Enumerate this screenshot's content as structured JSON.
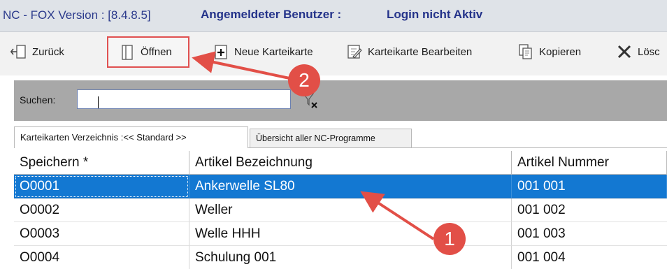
{
  "titlebar": {
    "version": "NC - FOX Version : [8.4.8.5]",
    "user_label": "Angemeldeter Benutzer :",
    "user_value": "Login nicht Aktiv"
  },
  "toolbar": {
    "back_label": "Zurück",
    "open_label": "Öffnen",
    "new_label": "Neue Karteikarte",
    "edit_label": "Karteikarte Bearbeiten",
    "copy_label": "Kopieren",
    "delete_label": "Lösc"
  },
  "search": {
    "label": "Suchen:",
    "value": ""
  },
  "tabs": [
    {
      "label": "Karteikarten Verzeichnis :<< Standard >>"
    },
    {
      "label": "Übersicht aller NC-Programme"
    }
  ],
  "table": {
    "columns": [
      "Speichern *",
      "Artikel Bezeichnung",
      "Artikel Nummer"
    ],
    "rows": [
      [
        "O0001",
        "Ankerwelle SL80",
        "001 001"
      ],
      [
        "O0002",
        "Weller",
        "001 002"
      ],
      [
        "O0003",
        "Welle HHH",
        "001 003"
      ],
      [
        "O0004",
        "Schulung 001",
        "001 004"
      ]
    ],
    "selected_row": 0
  },
  "annotations": {
    "badge_1": "1",
    "badge_2": "2"
  },
  "colors": {
    "selection": "#1378d2",
    "annotation": "#e24f47",
    "titlebar_text": "#24338a"
  }
}
